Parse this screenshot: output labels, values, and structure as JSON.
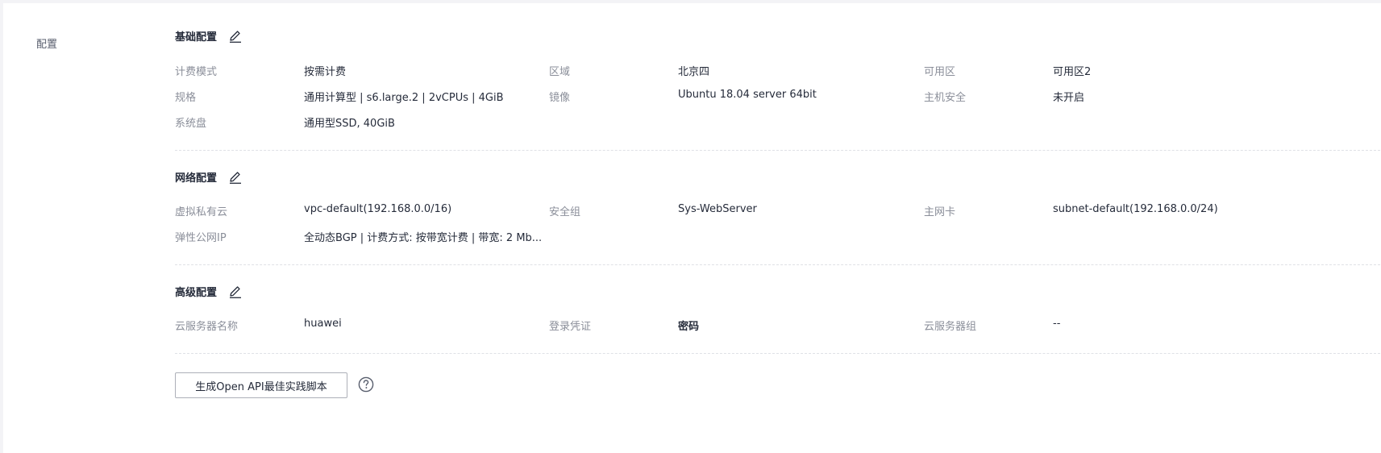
{
  "side": {
    "label": "配置"
  },
  "basic": {
    "title": "基础配置",
    "edit_icon": "edit-icon",
    "rows": [
      [
        {
          "label": "计费模式",
          "value": "按需计费"
        },
        {
          "label": "区域",
          "value": "北京四"
        },
        {
          "label": "可用区",
          "value": "可用区2"
        }
      ],
      [
        {
          "label": "规格",
          "value": "通用计算型 | s6.large.2 | 2vCPUs | 4GiB"
        },
        {
          "label": "镜像",
          "value": "Ubuntu 18.04 server 64bit"
        },
        {
          "label": "主机安全",
          "value": "未开启"
        }
      ],
      [
        {
          "label": "系统盘",
          "value": "通用型SSD, 40GiB"
        }
      ]
    ]
  },
  "network": {
    "title": "网络配置",
    "edit_icon": "edit-icon",
    "rows": [
      [
        {
          "label": "虚拟私有云",
          "value": "vpc-default(192.168.0.0/16)"
        },
        {
          "label": "安全组",
          "value": "Sys-WebServer"
        },
        {
          "label": "主网卡",
          "value": "subnet-default(192.168.0.0/24)"
        }
      ],
      [
        {
          "label": "弹性公网IP",
          "value": "全动态BGP | 计费方式: 按带宽计费 | 带宽: 2 Mb..."
        }
      ]
    ]
  },
  "advanced": {
    "title": "高级配置",
    "edit_icon": "edit-icon",
    "rows": [
      [
        {
          "label": "云服务器名称",
          "value": "huawei"
        },
        {
          "label": "登录凭证",
          "value": "密码"
        },
        {
          "label": "云服务器组",
          "value": "--"
        }
      ]
    ]
  },
  "footer": {
    "api_button_label": "生成Open API最佳实践脚本",
    "help_icon": "question-circle-icon"
  },
  "colors": {
    "label": "#8a8e99",
    "value": "#252b3a",
    "divider": "#dfe1e6"
  }
}
